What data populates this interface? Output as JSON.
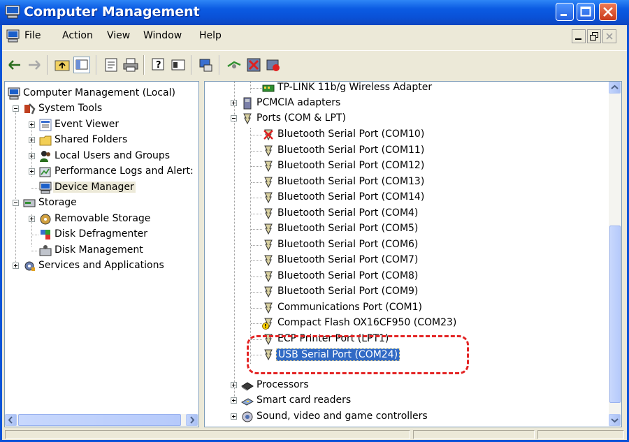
{
  "window": {
    "title": "Computer Management"
  },
  "menu": {
    "items": [
      "File",
      "Action",
      "View",
      "Window",
      "Help"
    ]
  },
  "toolbar": {
    "buttons": [
      "back-arrow-icon",
      "forward-arrow-icon",
      "up-folder-icon",
      "show-hide-tree-icon",
      "properties-icon",
      "print-icon",
      "help-icon",
      "console-tree-icon",
      "scan-hardware-icon",
      "update-driver-icon",
      "uninstall-icon",
      "disable-icon"
    ]
  },
  "tree": {
    "root": "Computer Management (Local)",
    "system_tools": "System Tools",
    "event_viewer": "Event Viewer",
    "shared_folders": "Shared Folders",
    "local_users": "Local Users and Groups",
    "perf_logs": "Performance Logs and Alert:",
    "device_manager": "Device Manager",
    "storage": "Storage",
    "removable_storage": "Removable Storage",
    "disk_defrag": "Disk Defragmenter",
    "disk_mgmt": "Disk Management",
    "services": "Services and Applications"
  },
  "devices": {
    "tplink": "TP-LINK 11b/g Wireless Adapter",
    "pcmcia": "PCMCIA adapters",
    "ports": "Ports (COM & LPT)",
    "port_items": [
      "Bluetooth Serial Port (COM10)",
      "Bluetooth Serial Port (COM11)",
      "Bluetooth Serial Port (COM12)",
      "Bluetooth Serial Port (COM13)",
      "Bluetooth Serial Port (COM14)",
      "Bluetooth Serial Port (COM4)",
      "Bluetooth Serial Port (COM5)",
      "Bluetooth Serial Port (COM6)",
      "Bluetooth Serial Port (COM7)",
      "Bluetooth Serial Port (COM8)",
      "Bluetooth Serial Port (COM9)",
      "Communications Port (COM1)",
      "Compact Flash OX16CF950 (COM23)",
      "ECP Printer Port (LPT1)",
      "USB Serial Port (COM24)"
    ],
    "processors": "Processors",
    "smart_card": "Smart card readers",
    "sound": "Sound, video and game controllers"
  },
  "colors": {
    "title_bar": "#0a53d8",
    "selection": "#316ac5",
    "highlight": "#e32424"
  }
}
